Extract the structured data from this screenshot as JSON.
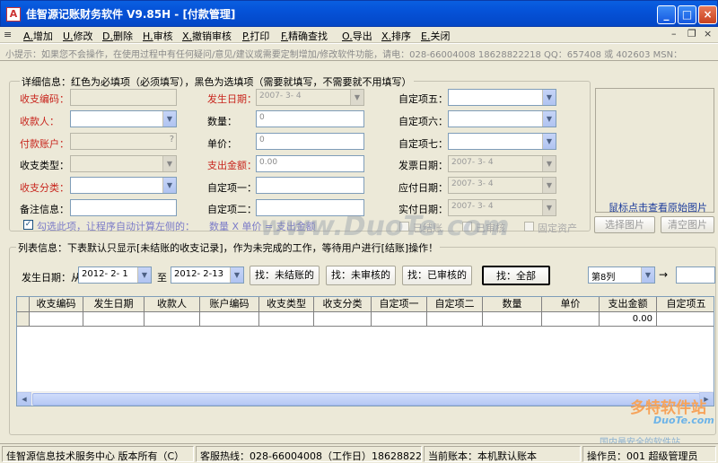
{
  "window": {
    "title": "佳智源记账财务软件   V9.85H - [付款管理]",
    "app_icon": "A"
  },
  "menu": [
    {
      "key": "A.",
      "label": "增加"
    },
    {
      "key": "U.",
      "label": "修改"
    },
    {
      "key": "D.",
      "label": "删除"
    },
    {
      "key": "H.",
      "label": "审核"
    },
    {
      "key": "X.",
      "label": "撤销审核"
    },
    {
      "key": "P.",
      "label": "打印"
    },
    {
      "key": "F.",
      "label": "精确查找"
    },
    {
      "key": "O.",
      "label": "导出"
    },
    {
      "key": "X.",
      "label": "排序"
    },
    {
      "key": "E.",
      "label": "关闭"
    }
  ],
  "tip": "小提示：如果您不会操作，在使用过程中有任何疑问/意见/建议或需要定制增加/修改软件功能，请电：028-66004008 18628822218 QQ：657408 或 402603 MSN：",
  "detail": {
    "legend": "详细信息：红色为必填项（必须填写），黑色为选填项（需要就填写，不需要就不用填写）",
    "fields": {
      "code": "收支编码：",
      "payee": "收款人：",
      "account": "付款账户：",
      "type": "收支类型：",
      "category": "收支分类：",
      "remark": "备注信息：",
      "date": "发生日期：",
      "quantity": "数量：",
      "price": "单价：",
      "amount": "支出金额：",
      "custom1": "自定项一：",
      "custom2": "自定项二：",
      "custom5": "自定项五：",
      "custom6": "自定项六：",
      "custom7": "自定项七：",
      "invoice_date": "发票日期：",
      "due_date": "应付日期：",
      "paid_date": "实付日期："
    },
    "values": {
      "date": "2007- 3- 4",
      "quantity": "0",
      "price": "0",
      "amount": "0.00",
      "invoice_date": "2007- 3- 4",
      "due_date": "2007- 3- 4",
      "paid_date": "2007- 3- 4"
    },
    "auto_calc_label": "勾选此项，让程序自动计算左侧的：",
    "formula": "数量 X 单价 = 支出金额",
    "checks": {
      "settled": "已结账",
      "audited": "已审核",
      "fixed_asset": "固定资产"
    },
    "image_hint": "鼠标点击查看原始图片",
    "choose_image": "选择图片",
    "clear_image": "清空图片"
  },
  "list": {
    "legend": "列表信息：下表默认只显示[未结账的收支记录]，作为未完成的工作，等待用户进行[结账]操作！",
    "date_label": "发生日期：从",
    "date_from": "2012- 2- 1",
    "to_label": "至",
    "date_to": "2012- 2-13",
    "btn_unsettled": "找：未结账的",
    "btn_unaudited": "找：未审核的",
    "btn_audited": "找：已审核的",
    "btn_all": "找：全部",
    "column_select": "第8列",
    "arrow": "→",
    "columns": [
      "收支编码",
      "发生日期",
      "收款人",
      "账户编码",
      "收支类型",
      "收支分类",
      "自定项一",
      "自定项二",
      "数量",
      "单价",
      "支出金额",
      "自定项五",
      "自"
    ],
    "rows": [
      [
        "",
        "",
        "",
        "",
        "",
        "",
        "",
        "",
        "",
        "",
        "0.00",
        "",
        ""
      ]
    ]
  },
  "status": {
    "company": "佳智源信息技术服务中心  版本所有（C）",
    "hotline": "客服热线：028-66004008（工作日）18628822218（节假日",
    "ledger": "当前账本：本机默认账本",
    "operator": "操作员：001 超级管理员"
  },
  "watermark": {
    "main": "www.DuoTe.com",
    "logo": "多特软件站",
    "logo_sub": "DuoTe.com",
    "logo_caption": "国内最安全的软件站"
  }
}
